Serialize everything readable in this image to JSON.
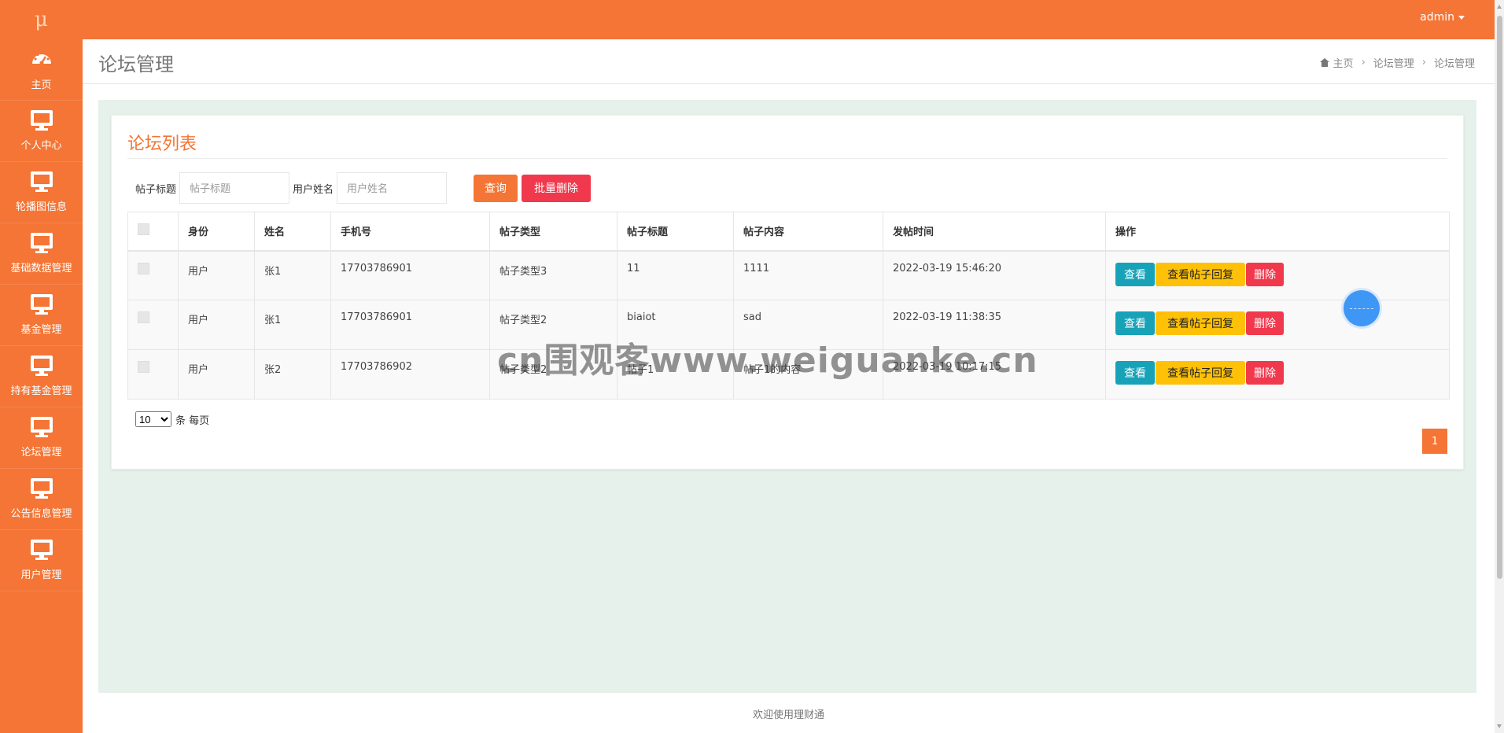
{
  "topbar": {
    "logo": "μ",
    "user": "admin"
  },
  "sidebar": {
    "items": [
      {
        "label": "主页",
        "icon": "dashboard-icon"
      },
      {
        "label": "个人中心",
        "icon": "monitor-icon"
      },
      {
        "label": "轮播图信息",
        "icon": "monitor-icon"
      },
      {
        "label": "基础数据管理",
        "icon": "monitor-icon"
      },
      {
        "label": "基金管理",
        "icon": "monitor-icon"
      },
      {
        "label": "持有基金管理",
        "icon": "monitor-icon"
      },
      {
        "label": "论坛管理",
        "icon": "monitor-icon"
      },
      {
        "label": "公告信息管理",
        "icon": "monitor-icon"
      },
      {
        "label": "用户管理",
        "icon": "monitor-icon"
      }
    ]
  },
  "header": {
    "title": "论坛管理",
    "breadcrumb": [
      "主页",
      "论坛管理",
      "论坛管理"
    ]
  },
  "card": {
    "title": "论坛列表",
    "search": {
      "title_label": "帖子标题",
      "title_placeholder": "帖子标题",
      "user_label": "用户姓名",
      "user_placeholder": "用户姓名",
      "query_button": "查询",
      "batch_delete_button": "批量删除"
    },
    "table": {
      "columns": [
        "身份",
        "姓名",
        "手机号",
        "帖子类型",
        "帖子标题",
        "帖子内容",
        "发帖时间",
        "操作"
      ],
      "rows": [
        [
          "用户",
          "张1",
          "17703786901",
          "帖子类型3",
          "11",
          "1111",
          "2022-03-19 15:46:20"
        ],
        [
          "用户",
          "张1",
          "17703786901",
          "帖子类型2",
          "biaiot",
          "sad",
          "2022-03-19 11:38:35"
        ],
        [
          "用户",
          "张2",
          "17703786902",
          "帖子类型2",
          "帖子1",
          "帖子1的内容",
          "2022-03-19 10:17:15"
        ]
      ],
      "actions": {
        "view": "查看",
        "view_replies": "查看帖子回复",
        "delete": "删除"
      }
    },
    "pager": {
      "page_size": "10",
      "page_size_suffix": "条 每页",
      "current_page": "1"
    }
  },
  "footer": {
    "text": "欢迎使用理财通"
  },
  "watermark": "cn围观客www.weiguanke.cn",
  "colors": {
    "brand": "#f47535",
    "danger": "#f1394d",
    "info": "#17a2b8",
    "warning": "#ffc107",
    "content_bg": "#e5f1ea"
  }
}
